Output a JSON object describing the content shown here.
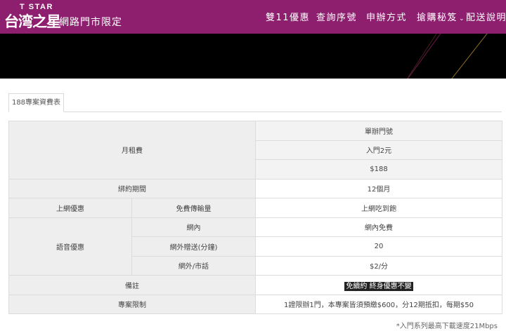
{
  "header": {
    "logo_top": "T STAR",
    "logo_main": "台湾之星",
    "logo_sub": "網路門市限定",
    "nav": [
      {
        "label": "雙11優惠"
      },
      {
        "label": "查詢序號"
      },
      {
        "label": "申辦方式"
      },
      {
        "label": "搶購秘笈",
        "has_dropdown": true
      },
      {
        "label": "配送說明"
      }
    ],
    "brand_color": "#8e1f6f"
  },
  "tabs": [
    {
      "label": "188專案資費表",
      "active": true
    }
  ],
  "plan_table": {
    "monthly_fee_label": "月租費",
    "plan_name": "單辦門號",
    "entry_price": "入門2元",
    "monthly_price": "$188",
    "contract_label": "綁約期間",
    "contract_value": "12個月",
    "data_label": "上網優惠",
    "data_sub_label": "免費傳輸量",
    "data_value": "上網吃到飽",
    "voice_label": "語音優惠",
    "voice_rows": [
      {
        "label": "網內",
        "value": "網內免費"
      },
      {
        "label": "網外贈送(分鐘)",
        "value": "20"
      },
      {
        "label": "網外/市話",
        "value": "$2/分"
      }
    ],
    "note_label": "備註",
    "note_value": "免續約 終身優惠不變",
    "limit_label": "專案限制",
    "limit_value": "1證限辦1門，本專案皆須預繳$600，分12期抵扣，每期$50"
  },
  "footnote": "*入門系列最高下載速度21Mbps"
}
